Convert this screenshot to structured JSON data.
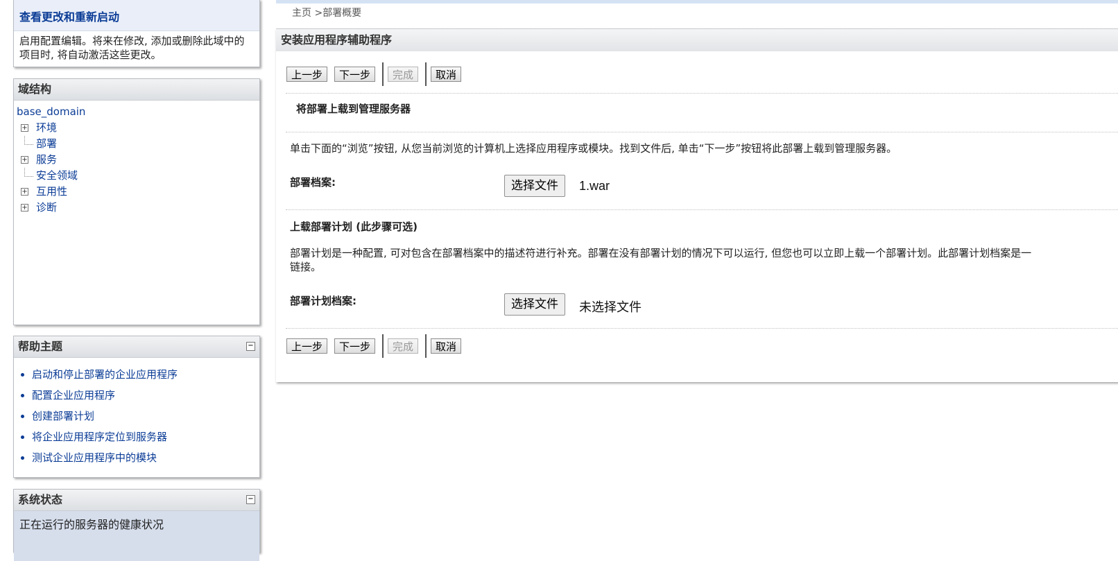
{
  "change_center": {
    "title": "查看更改和重新启动",
    "text": "启用配置编辑。将来在修改, 添加或删除此域中的项目时, 将自动激活这些更改。"
  },
  "domain_structure": {
    "title": "域结构",
    "root": "base_domain",
    "nodes": [
      {
        "label": "环境",
        "expandable": true
      },
      {
        "label": "部署",
        "expandable": false
      },
      {
        "label": "服务",
        "expandable": true
      },
      {
        "label": "安全领域",
        "expandable": false
      },
      {
        "label": "互用性",
        "expandable": true
      },
      {
        "label": "诊断",
        "expandable": true
      }
    ]
  },
  "help_topics": {
    "title": "帮助主题",
    "items": [
      "启动和停止部署的企业应用程序",
      "配置企业应用程序",
      "创建部署计划",
      "将企业应用程序定位到服务器",
      "测试企业应用程序中的模块"
    ]
  },
  "system_status": {
    "title": "系统状态",
    "text": "正在运行的服务器的健康状况"
  },
  "breadcrumb": {
    "home": "主页",
    "sep": " >",
    "current": "部署概要"
  },
  "wizard": {
    "title": "安装应用程序辅助程序",
    "buttons": {
      "back": "上一步",
      "next": "下一步",
      "finish": "完成",
      "cancel": "取消"
    },
    "upload_section_title": "将部署上载到管理服务器",
    "upload_instruction": "单击下面的“浏览”按钮, 从您当前浏览的计算机上选择应用程序或模块。找到文件后, 单击“下一步”按钮将此部署上载到管理服务器。",
    "archive_label": "部署档案:",
    "choose_file": "选择文件",
    "archive_file": "1.war",
    "plan_section_title": "上载部署计划 (此步骤可选)",
    "plan_text_line1": "部署计划是一种配置, 可对包含在部署档案中的描述符进行补充。部署在没有部署计划的情况下可以运行, 但您也可以立即上载一个部署计划。此部署计划档案是一",
    "plan_text_line2": "链接。",
    "plan_label": "部署计划档案:",
    "plan_file": "未选择文件"
  }
}
